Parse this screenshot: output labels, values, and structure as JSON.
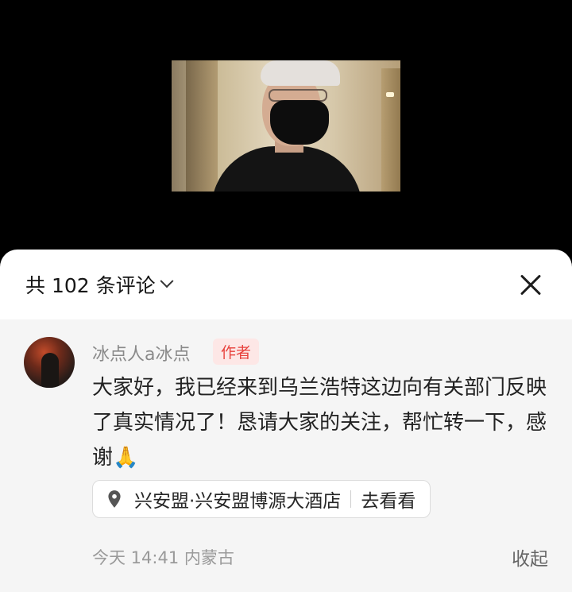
{
  "video": {
    "label": "video-frame"
  },
  "header": {
    "comment_count_label": "共 102 条评论"
  },
  "comment": {
    "author": "冰点人a冰点",
    "author_tag": "作者",
    "text": "大家好，我已经来到乌兰浩特这边向有关部门反映了真实情况了！恳请大家的关注，帮忙转一下，感谢🙏",
    "location": "兴安盟·兴安盟博源大酒店",
    "location_action": "去看看",
    "time": "今天 14:41",
    "region": "内蒙古",
    "collapse_label": "收起"
  },
  "colors": {
    "accent_red": "#e8423d",
    "meta_gray": "#9a9a9a",
    "sheet_bg": "#f5f5f5"
  },
  "icons": {
    "close": "close-icon",
    "chevron": "chevron-down-icon",
    "location": "location-pin-icon"
  }
}
